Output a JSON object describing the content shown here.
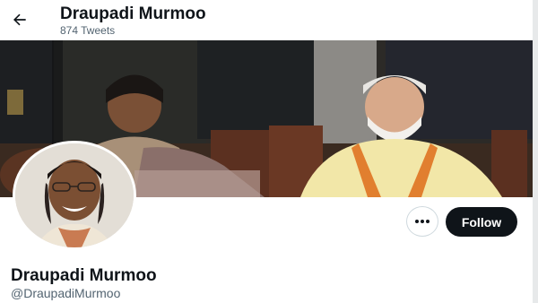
{
  "header": {
    "title": "Draupadi Murmoo",
    "tweet_count": "874 Tweets"
  },
  "banner": {
    "alt": "Banner photo"
  },
  "profile": {
    "display_name": "Draupadi Murmoo",
    "handle": "@DraupadiMurmoo"
  },
  "actions": {
    "follow_label": "Follow",
    "more_icon": "more-horizontal-icon"
  },
  "colors": {
    "primary_text": "#0f1419",
    "secondary_text": "#536471",
    "follow_bg": "#0f1419",
    "border": "#cfd9de"
  }
}
